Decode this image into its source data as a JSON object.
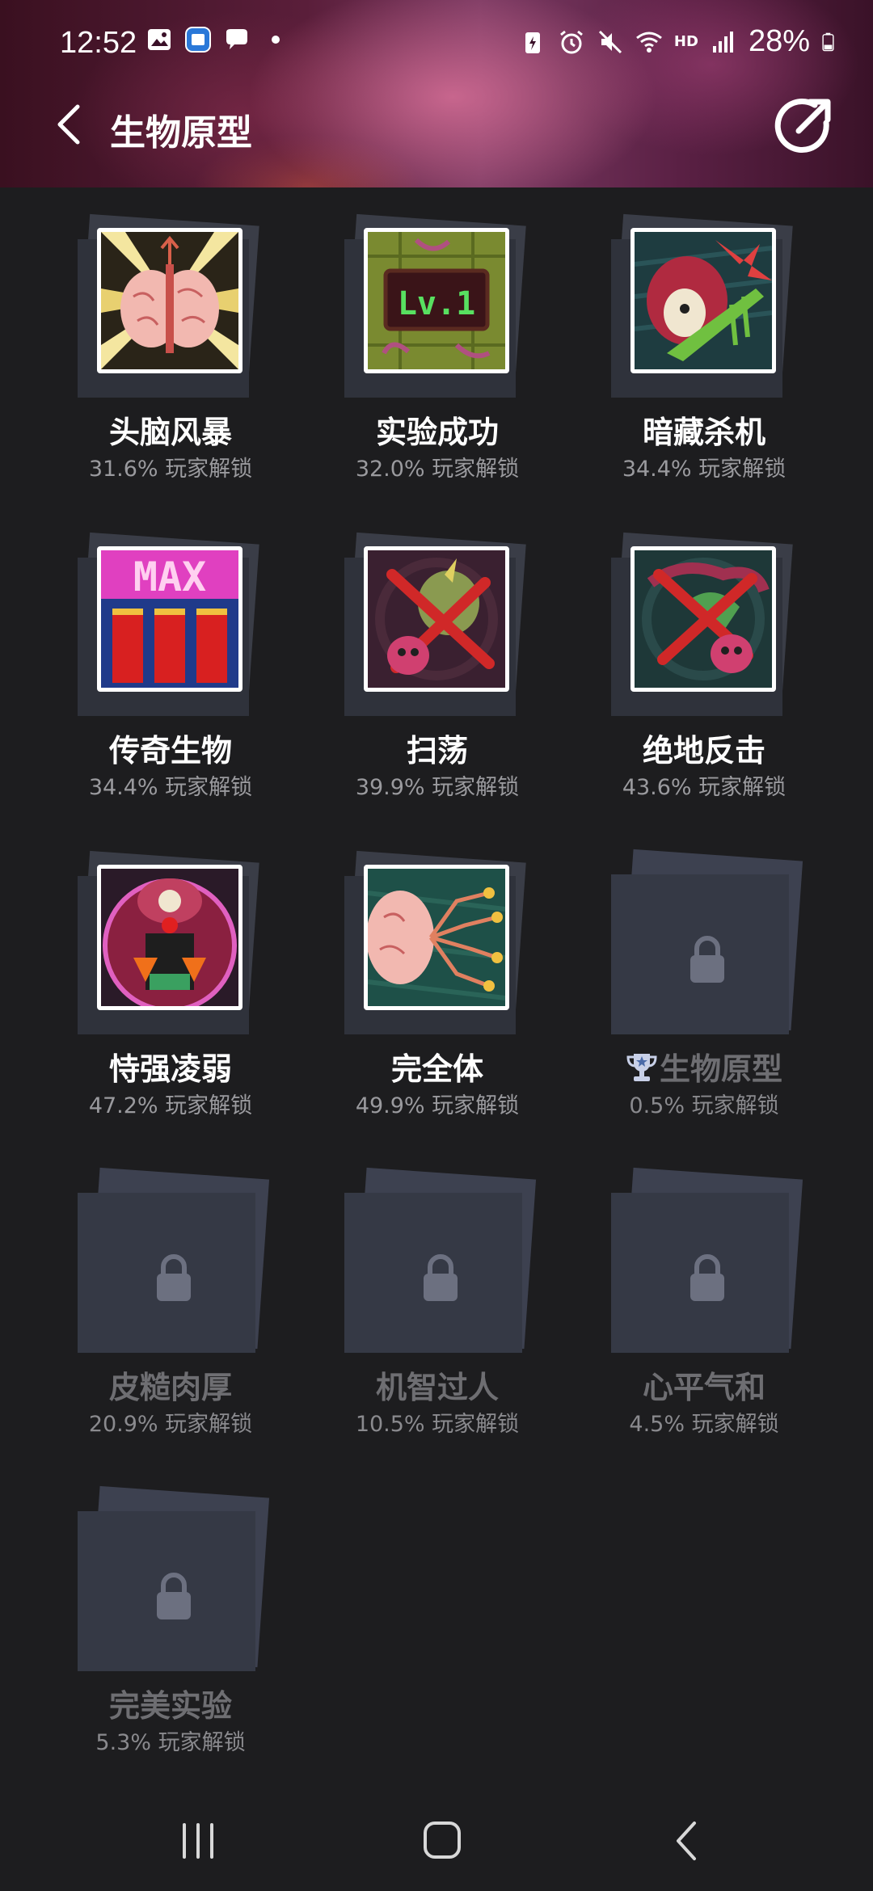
{
  "status_bar": {
    "time": "12:52",
    "battery": "28%",
    "hd": "HD"
  },
  "header": {
    "title": "生物原型"
  },
  "achievements": [
    {
      "name": "头脑风暴",
      "percent": "31.6% 玩家解锁",
      "locked": false,
      "icon": "brain-burst-icon"
    },
    {
      "name": "实验成功",
      "percent": "32.0% 玩家解锁",
      "locked": false,
      "icon": "lv1-icon",
      "art_text": "Lv.1"
    },
    {
      "name": "暗藏杀机",
      "percent": "34.4% 玩家解锁",
      "locked": false,
      "icon": "hidden-killer-icon"
    },
    {
      "name": "传奇生物",
      "percent": "34.4% 玩家解锁",
      "locked": false,
      "icon": "max-icon",
      "art_text": "MAX"
    },
    {
      "name": "扫荡",
      "percent": "39.9% 玩家解锁",
      "locked": false,
      "icon": "sweep-icon"
    },
    {
      "name": "绝地反击",
      "percent": "43.6% 玩家解锁",
      "locked": false,
      "icon": "counterattack-icon"
    },
    {
      "name": "恃强凌弱",
      "percent": "47.2% 玩家解锁",
      "locked": false,
      "icon": "bully-icon"
    },
    {
      "name": "完全体",
      "percent": "49.9% 玩家解锁",
      "locked": false,
      "icon": "complete-form-icon"
    },
    {
      "name": "生物原型",
      "percent": "0.5% 玩家解锁",
      "locked": true,
      "trophy": true
    },
    {
      "name": "皮糙肉厚",
      "percent": "20.9% 玩家解锁",
      "locked": true
    },
    {
      "name": "机智过人",
      "percent": "10.5% 玩家解锁",
      "locked": true
    },
    {
      "name": "心平气和",
      "percent": "4.5% 玩家解锁",
      "locked": true
    },
    {
      "name": "完美实验",
      "percent": "5.3% 玩家解锁",
      "locked": true
    }
  ]
}
